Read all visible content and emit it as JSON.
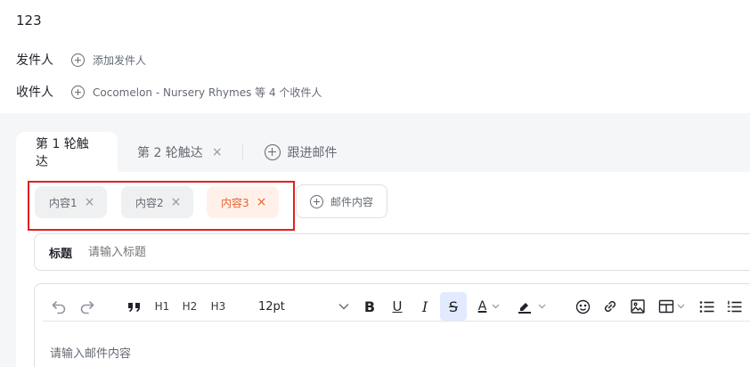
{
  "email": {
    "title": "123",
    "sender_label": "发件人",
    "sender_add_text": "添加发件人",
    "recipient_label": "收件人",
    "recipient_summary": "Cocomelon - Nursery Rhymes 等 4 个收件人"
  },
  "tabs": [
    {
      "label": "第 1 轮触达",
      "active": true
    },
    {
      "label": "第 2 轮触达",
      "active": false,
      "close": "×"
    }
  ],
  "followup_tab_label": "跟进邮件",
  "content_chips": [
    {
      "label": "内容1",
      "close": "×",
      "active": false
    },
    {
      "label": "内容2",
      "close": "×",
      "active": false
    },
    {
      "label": "内容3",
      "close": "×",
      "active": true
    }
  ],
  "add_content_label": "邮件内容",
  "subject": {
    "label": "标题",
    "placeholder": "请输入标题"
  },
  "toolbar": {
    "h1": "H1",
    "h2": "H2",
    "h3": "H3",
    "font_size": "12pt",
    "bold": "B",
    "underline": "U",
    "italic": "I",
    "strike": "S",
    "text_color": "A"
  },
  "body_placeholder": "请输入邮件内容",
  "colors": {
    "accent": "#e8602c",
    "highlight_border": "#e02020",
    "active_toggle": "#e1eaff"
  },
  "icons": [
    "undo-icon",
    "redo-icon",
    "quote-icon",
    "chevron-down-icon",
    "emoji-icon",
    "link-icon",
    "image-icon",
    "table-icon",
    "bullet-list-icon",
    "numbered-list-icon",
    "add-circle-icon",
    "close-icon"
  ]
}
